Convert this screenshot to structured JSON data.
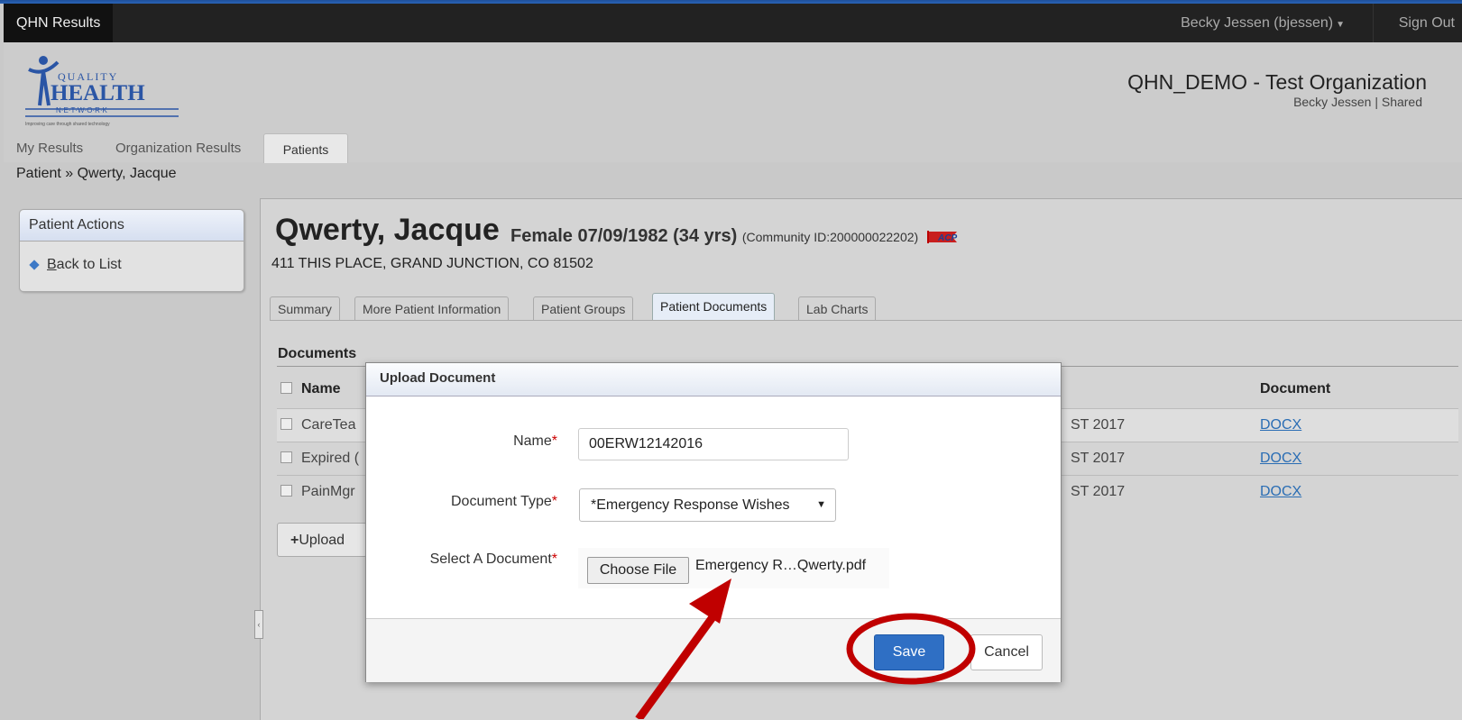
{
  "topbar": {
    "app_title": "QHN Results",
    "user": "Becky Jessen (bjessen)",
    "signout": "Sign Out"
  },
  "header": {
    "logo_top": "QUALITY",
    "logo_main": "HEALTH",
    "logo_sub": "N·E·T·W·O·R·K",
    "logo_tagline": "Improving care through shared technology",
    "org_name": "QHN_DEMO - Test Organization",
    "org_sub": "Becky Jessen | Shared"
  },
  "nav": {
    "my_results": "My Results",
    "org_results": "Organization Results",
    "patients": "Patients"
  },
  "breadcrumb": "Patient » Qwerty, Jacque",
  "actions": {
    "title": "Patient Actions",
    "back_prefix": "B",
    "back_rest": "ack to List"
  },
  "patient": {
    "name": "Qwerty, Jacque",
    "sex_dob": "Female  07/09/1982 (34 yrs)",
    "community_id": "(Community ID:200000022202)",
    "acp_badge": "ACP",
    "address": "411 THIS PLACE, GRAND JUNCTION, CO 81502"
  },
  "tabs": [
    "Summary",
    "More Patient Information",
    "Patient Groups",
    "Patient Documents",
    "Lab Charts"
  ],
  "documents": {
    "title": "Documents",
    "col_name": "Name",
    "col_document": "Document",
    "rows": [
      {
        "name": "CareTea",
        "date": "ST 2017",
        "doc": "DOCX"
      },
      {
        "name": "Expired (",
        "date": "ST 2017",
        "doc": "DOCX"
      },
      {
        "name": "PainMgr",
        "date": "ST 2017",
        "doc": "DOCX"
      }
    ],
    "upload_label": "Upload"
  },
  "modal": {
    "title": "Upload Document",
    "name_label": "Name",
    "name_value": "00ERW12142016",
    "type_label": "Document Type",
    "type_value": "*Emergency Response Wishes",
    "file_label": "Select A Document",
    "choose_file": "Choose File",
    "file_name": "Emergency R…Qwerty.pdf",
    "save": "Save",
    "cancel": "Cancel",
    "required_mark": "*"
  },
  "colors": {
    "accent_blue": "#2f6fc4",
    "annotation_red": "#c00000",
    "topbar": "#222222"
  }
}
